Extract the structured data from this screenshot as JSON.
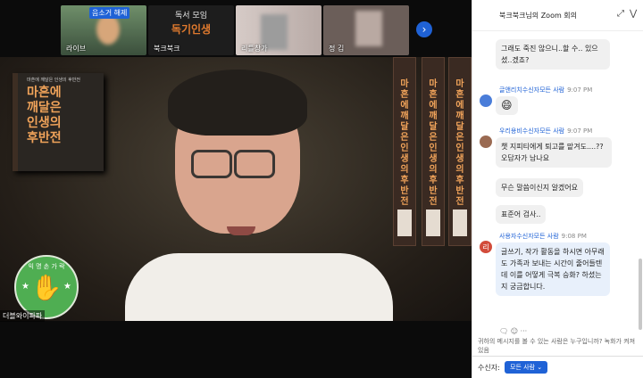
{
  "thumbnails": [
    {
      "name": "라이브",
      "badge": "음소거 해제"
    },
    {
      "line1": "독서 모임",
      "line2": "독기인생",
      "name": "북크북크"
    },
    {
      "name": "리틀창가"
    },
    {
      "name": "정 김"
    }
  ],
  "next_glyph": "›",
  "main_book": {
    "small_text": "마흔에 깨달은 인생의 후반전",
    "title_lines": [
      "마흔에",
      "깨달은",
      "인생의",
      "후반전"
    ]
  },
  "spine_text": "마흔에 깨달은 인생의 후반전",
  "badge": {
    "top": "익 명 손 가 락",
    "hand": "✋",
    "star": "★"
  },
  "speaker_name": "더블와이파파",
  "chat": {
    "title": "북크북크님의 Zoom 회의",
    "header_icons": [
      "⤢",
      "⋁"
    ],
    "messages": [
      {
        "text": "그래도 죽진 않으니..할 수.. 있으셨..겠죠?"
      },
      {
        "sender": "글앤리치",
        "to": "수신자",
        "audience": "모든 사람",
        "time": "9:07 PM",
        "text": "😄",
        "avatar_color": "#4a7dd9"
      },
      {
        "sender": "우리용비",
        "to": "수신자",
        "audience": "모든 사람",
        "time": "9:07 PM",
        "text": "챗 지피티에게 퇴고를 맡겨도....?? 오답자가 남나요",
        "avatar_color": "#9a6a52"
      },
      {
        "text": "무슨 말씀이신지 알겠어요"
      },
      {
        "text": "표준어 검사.."
      },
      {
        "sender": "사용자",
        "to": "수신자",
        "audience": "모든 사람",
        "time": "9:08 PM",
        "text": "글쓰기, 작가 활동을 하시면 아무래도 가족과 보내는 시간이 줄어들텐데 이를 어떻게 극복 승화? 하셨는지 궁금합니다.",
        "avatar_letter": "리",
        "avatar_color": "#d24b3a"
      }
    ],
    "reactions": "🗨 ☺ ···",
    "notice": "귀하의 메시지를 볼 수 있는 사람은 누구입니까? 녹화가 켜져 있음",
    "to_label": "수신자:",
    "to_value": "모든 사람 ⌄"
  }
}
